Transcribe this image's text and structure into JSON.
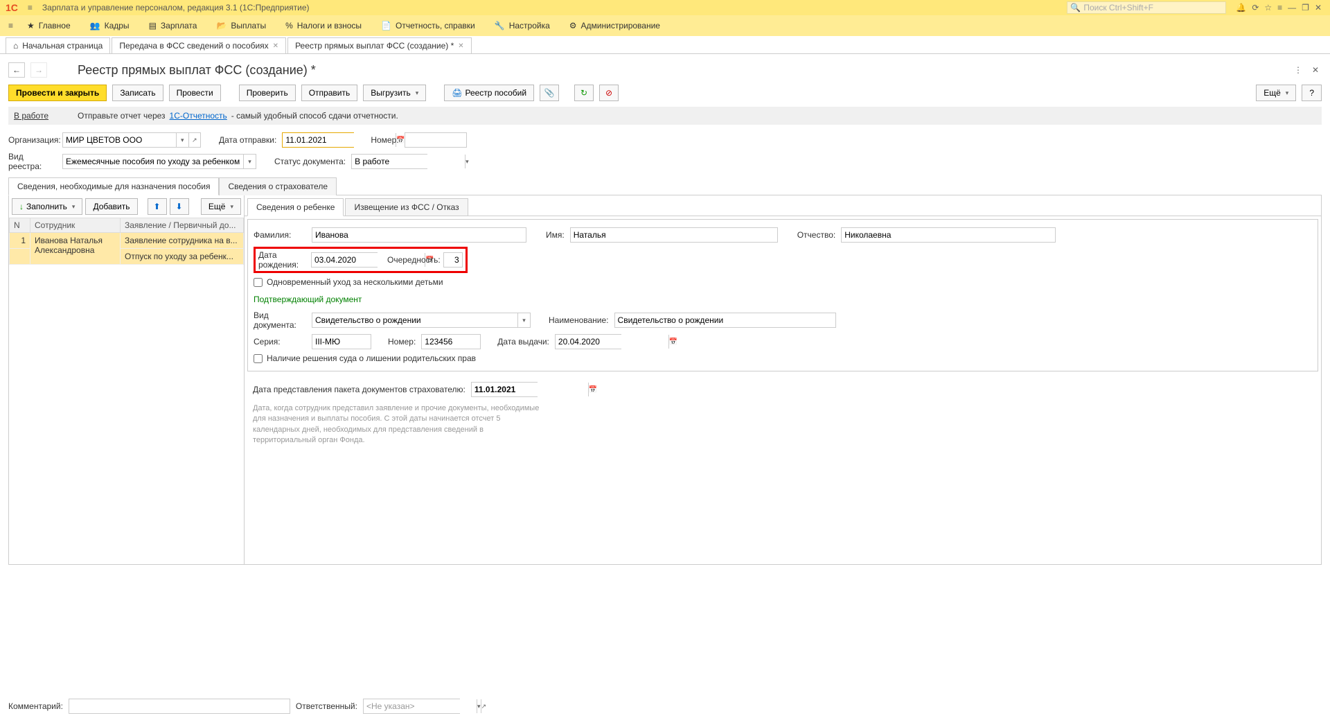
{
  "title": {
    "app": "Зарплата и управление персоналом, редакция 3.1  (1С:Предприятие)"
  },
  "search": {
    "placeholder": "Поиск Ctrl+Shift+F"
  },
  "menu": {
    "main": "Главное",
    "cadres": "Кадры",
    "salary": "Зарплата",
    "payments": "Выплаты",
    "taxes": "Налоги и взносы",
    "reports": "Отчетность, справки",
    "settings": "Настройка",
    "admin": "Администрирование"
  },
  "tabs": {
    "home": "Начальная страница",
    "t1": "Передача в ФСС сведений о пособиях",
    "t2": "Реестр прямых выплат ФСС (создание) *"
  },
  "page": {
    "title": "Реестр прямых выплат ФСС (создание) *",
    "toolbar": {
      "post_close": "Провести и закрыть",
      "save": "Записать",
      "post": "Провести",
      "check": "Проверить",
      "send": "Отправить",
      "upload": "Выгрузить",
      "registry": "Реестр пособий",
      "more": "Ещё",
      "help": "?"
    },
    "status": {
      "work": "В работе",
      "hint1": "Отправьте отчет через ",
      "link": "1С-Отчетность",
      "hint2": " - самый удобный способ сдачи отчетности."
    },
    "form": {
      "org_label": "Организация:",
      "org_value": "МИР ЦВЕТОВ ООО",
      "send_date_label": "Дата отправки:",
      "send_date": "11.01.2021",
      "number_label": "Номер:",
      "number": "",
      "reestr_type_label": "Вид реестра:",
      "reestr_type": "Ежемесячные пособия по уходу за ребенком",
      "status_label": "Статус документа:",
      "status": "В работе"
    },
    "inner_tabs": {
      "t1": "Сведения, необходимые для назначения пособия",
      "t2": "Сведения о страхователе"
    },
    "left": {
      "fill": "Заполнить",
      "add": "Добавить",
      "more": "Ещё",
      "cols": {
        "n": "N",
        "emp": "Сотрудник",
        "app": "Заявление / Первичный до..."
      },
      "rows": [
        {
          "n": "1",
          "emp": "Иванова Наталья Александровна",
          "app": "Заявление сотрудника на в..."
        },
        {
          "n": "",
          "emp": "",
          "app": "Отпуск по уходу за ребенк..."
        }
      ]
    },
    "right": {
      "tabs": {
        "t1": "Сведения о ребенке",
        "t2": "Извещение из ФСС / Отказ"
      },
      "surname_label": "Фамилия:",
      "surname": "Иванова",
      "name_label": "Имя:",
      "name": "Наталья",
      "patronymic_label": "Отчество:",
      "patronymic": "Николаевна",
      "birth_label": "Дата рождения:",
      "birth": "03.04.2020",
      "order_label": "Очередность:",
      "order": "3",
      "multi_label": "Одновременный уход за несколькими детьми",
      "section": "Подтверждающий документ",
      "doc_type_label": "Вид документа:",
      "doc_type": "Свидетельство о рождении",
      "doc_name_label": "Наименование:",
      "doc_name": "Свидетельство о рождении",
      "series_label": "Серия:",
      "series": "III-МЮ",
      "doc_number_label": "Номер:",
      "doc_number": "123456",
      "issue_label": "Дата выдачи:",
      "issue": "20.04.2020",
      "court_label": "Наличие решения суда о лишении родительских прав",
      "submit_date_label": "Дата представления пакета документов страхователю:",
      "submit_date": "11.01.2021",
      "help": "Дата, когда сотрудник представил заявление и прочие документы, необходимые для назначения и выплаты пособия. С этой даты начинается отсчет 5 календарных дней, необходимых для представления сведений в территориальный орган Фонда."
    }
  },
  "footer": {
    "comment_label": "Комментарий:",
    "comment": "",
    "responsible_label": "Ответственный:",
    "responsible": "<Не указан>"
  }
}
